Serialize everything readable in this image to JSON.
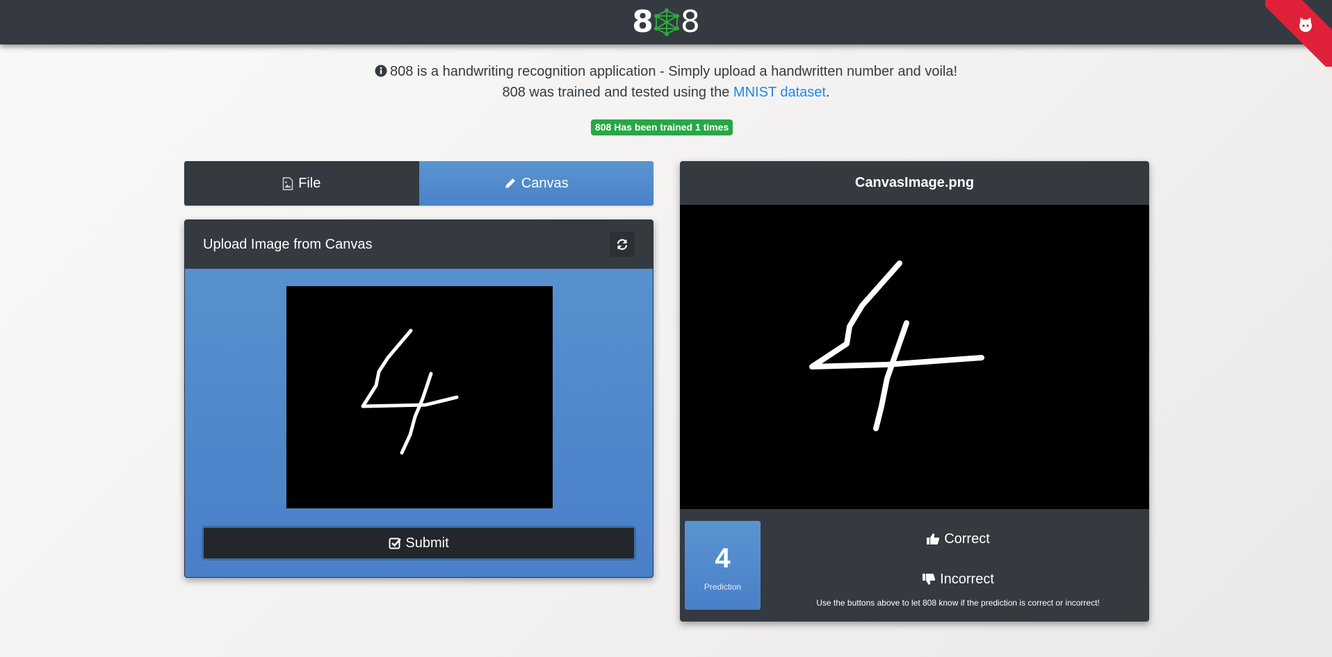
{
  "navbar": {
    "logo_text": [
      "8",
      "8"
    ],
    "github_corner_icon": "github-octocat-icon"
  },
  "intro": {
    "line1": "808 is a handwriting recognition application - Simply upload a handwritten number and voila!",
    "line2_prefix": "808 was trained and tested using the ",
    "line2_link": "MNIST dataset",
    "line2_suffix": "."
  },
  "badge": {
    "text": "808 Has been trained 1 times"
  },
  "tabs": [
    {
      "label": "File",
      "icon": "file-image-icon",
      "active": false
    },
    {
      "label": "Canvas",
      "icon": "pencil-icon",
      "active": true
    }
  ],
  "upload": {
    "title": "Upload Image from Canvas",
    "refresh_icon": "refresh-icon",
    "submit_label": "Submit",
    "submit_icon": "check-square-icon"
  },
  "result": {
    "title": "CanvasImage.png",
    "prediction_value": "4",
    "prediction_label": "Prediction",
    "correct_label": "Correct",
    "incorrect_label": "Incorrect",
    "note": "Use the buttons above to let 808 know if the prediction is correct or incorrect!"
  },
  "colors": {
    "navbar": "#343a40",
    "accent_blue": "#4a82c8",
    "badge_green": "#28a745",
    "link": "#1e88e5",
    "ribbon_red": "#e0213a"
  }
}
